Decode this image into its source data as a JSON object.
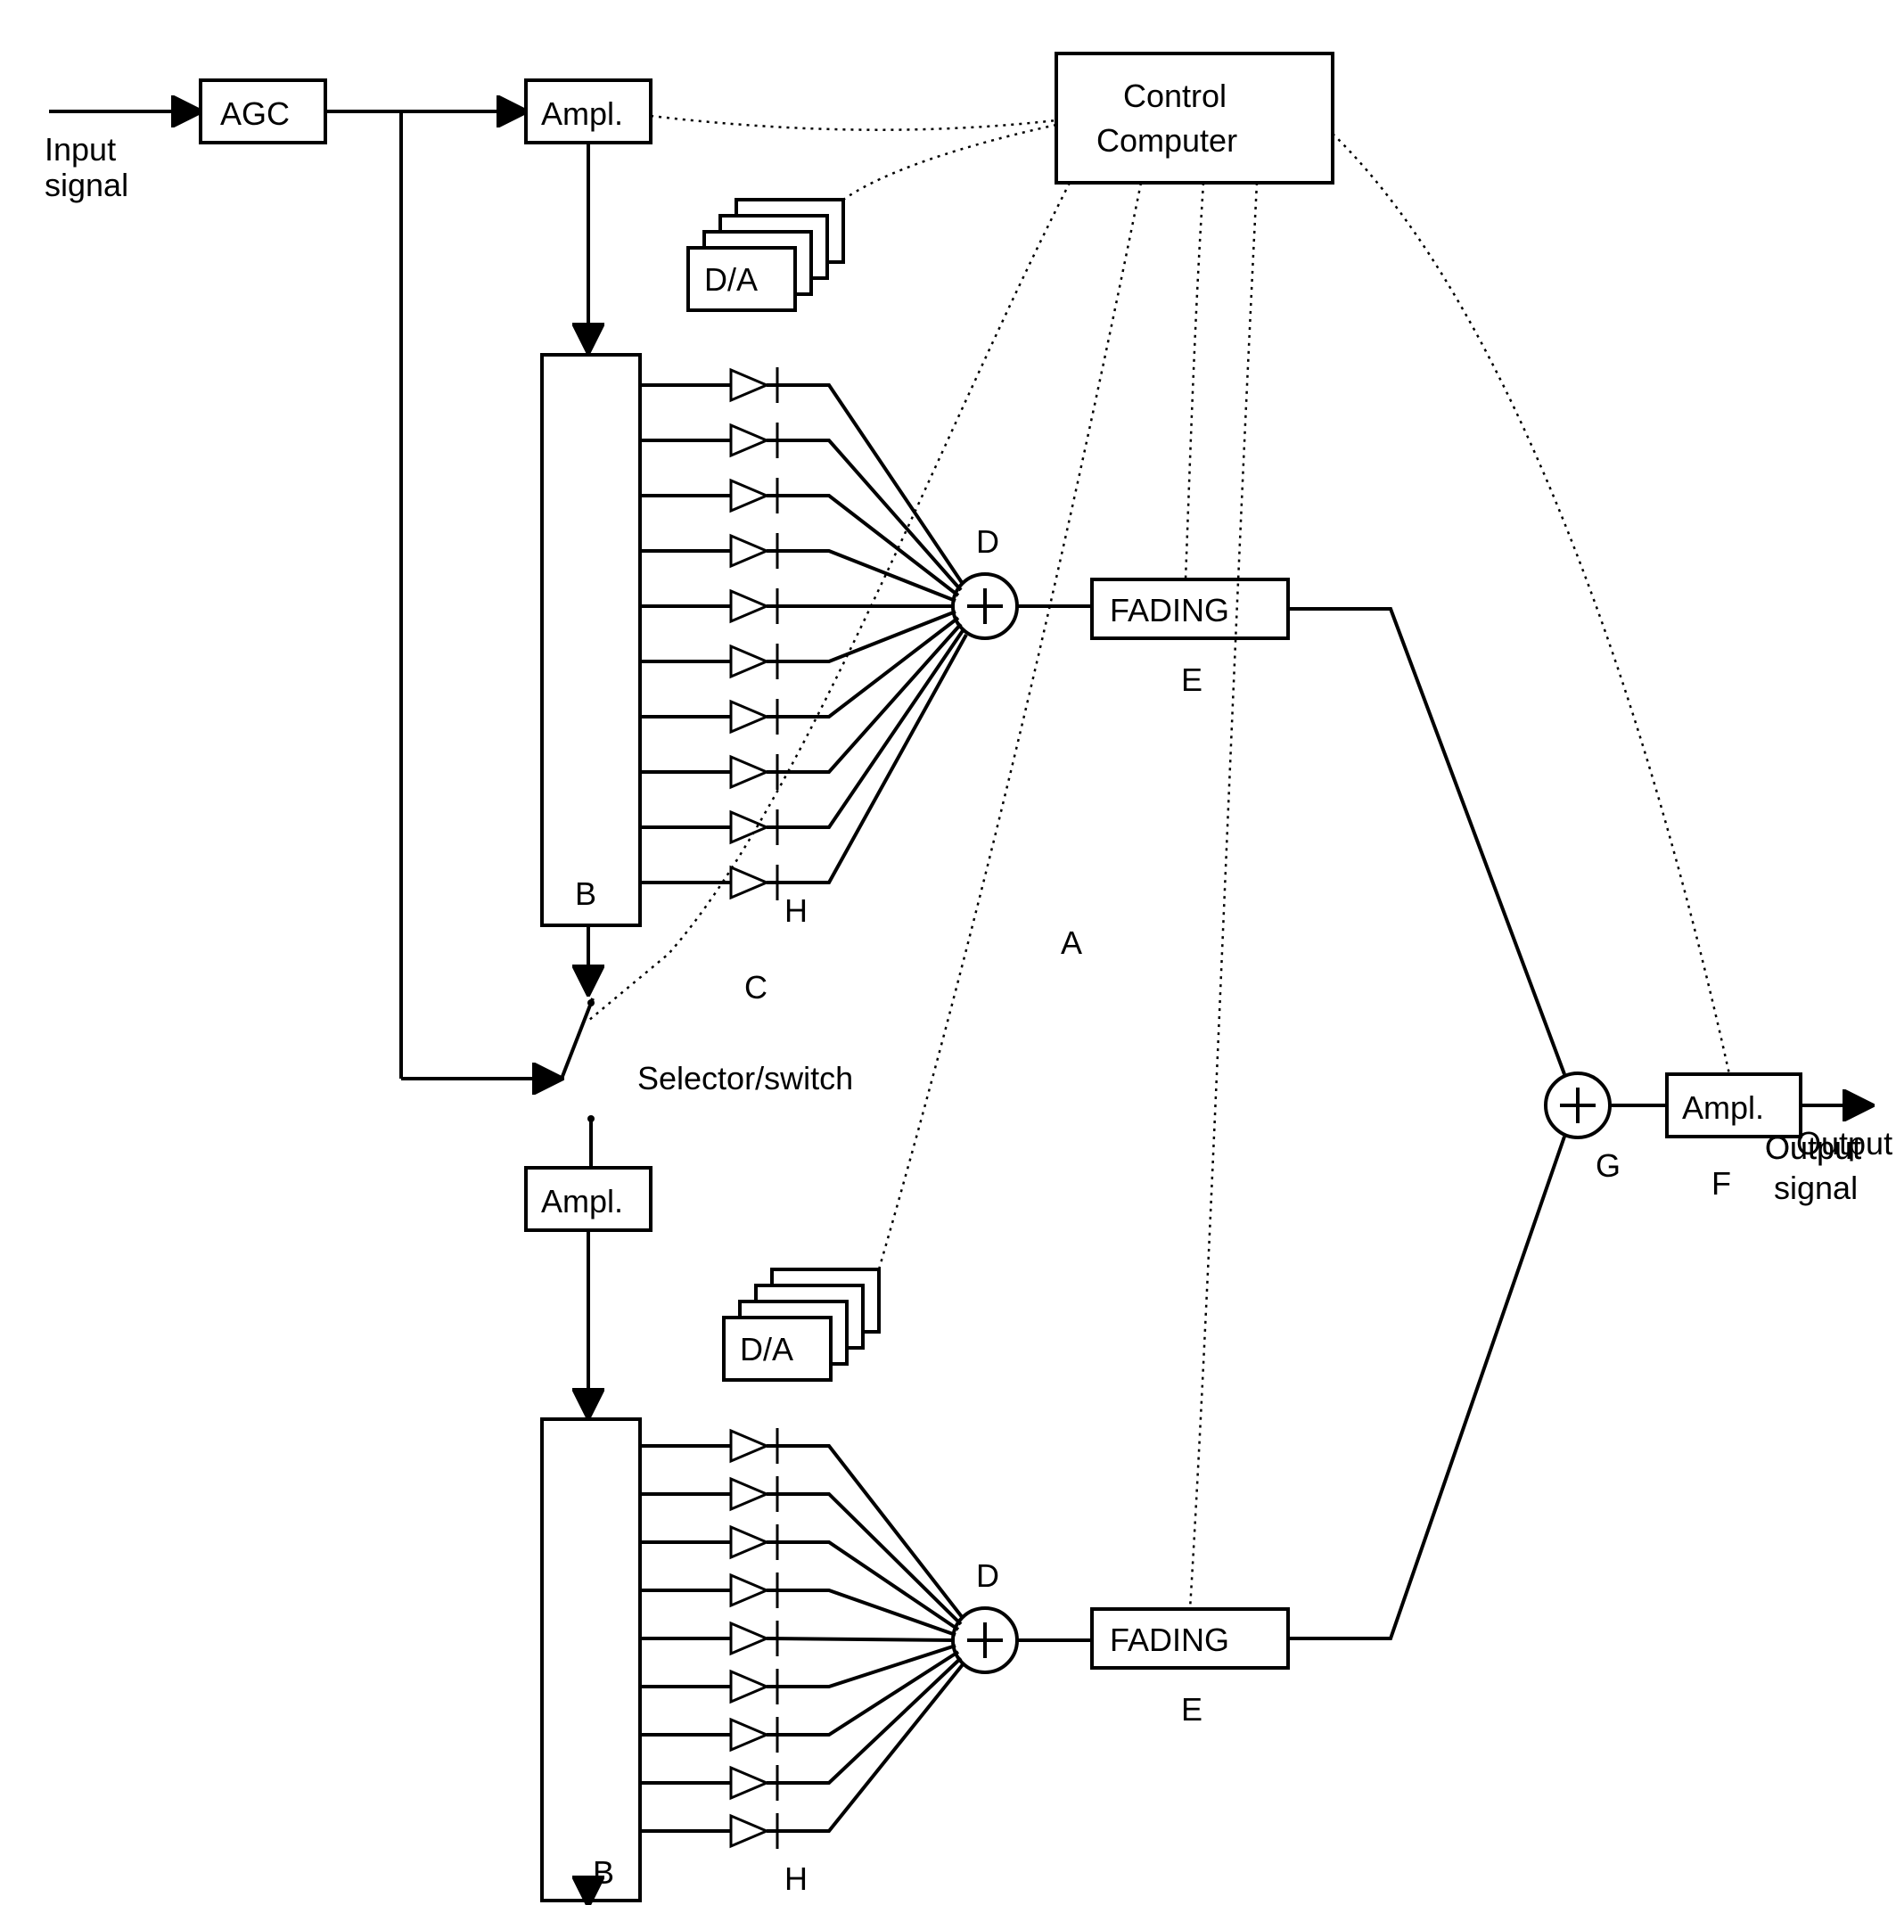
{
  "labels": {
    "input_signal": "Input",
    "input_signal_line2": "signal",
    "agc": "AGC",
    "ampl_top": "Ampl.",
    "ampl_mid": "Ampl.",
    "ampl_out": "Ampl.",
    "control_computer_line1": "Control",
    "control_computer_line2": "Computer",
    "da_top": "D/A",
    "da_bottom": "D/A",
    "fading_top": "FADING",
    "fading_bottom": "FADING",
    "selector_switch": "Selector/switch",
    "output_line1": "Output",
    "output_line2": "signal",
    "A": "A",
    "B_top": "B",
    "B_bottom": "B",
    "C": "C",
    "D_top": "D",
    "D_bottom": "D",
    "E_top": "E",
    "E_bottom": "E",
    "F": "F",
    "G": "G",
    "H_top": "H",
    "H_bottom": "H"
  }
}
